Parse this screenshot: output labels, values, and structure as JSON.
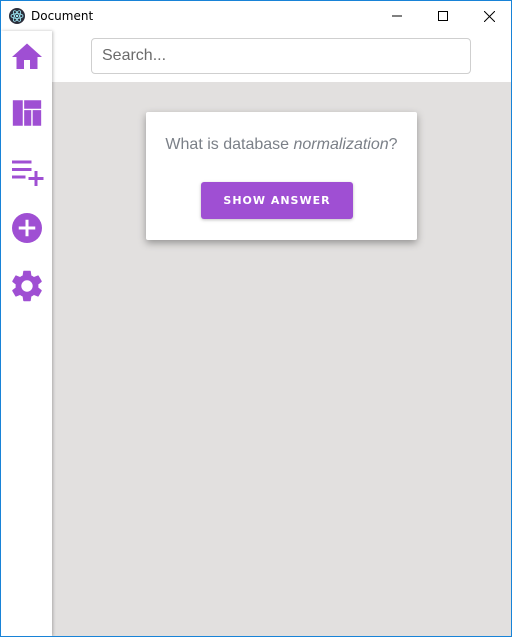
{
  "window": {
    "title": "Document"
  },
  "colors": {
    "accent": "#9f4fd3",
    "background": "#e2e0df",
    "text_muted": "#7b8088"
  },
  "sidebar": {
    "items": [
      {
        "icon": "home-icon"
      },
      {
        "icon": "dashboard-icon"
      },
      {
        "icon": "playlist-add-icon"
      },
      {
        "icon": "add-circle-icon"
      },
      {
        "icon": "settings-gear-icon"
      }
    ]
  },
  "search": {
    "placeholder": "Search..."
  },
  "card": {
    "question_prefix": "What is database ",
    "question_emphasis": "normalization",
    "question_suffix": "?",
    "button_label": "SHOW ANSWER"
  }
}
